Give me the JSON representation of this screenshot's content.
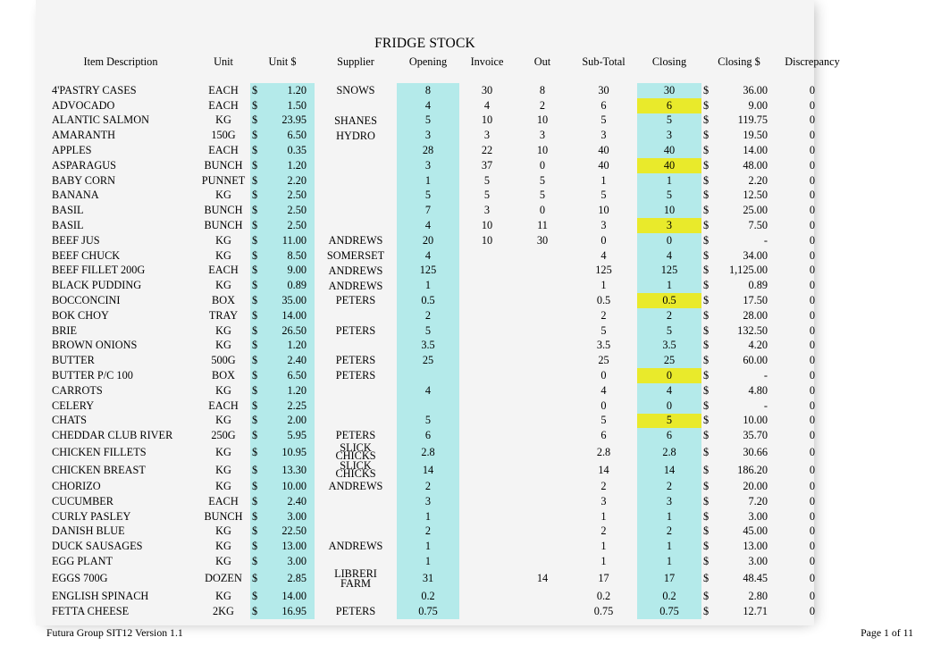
{
  "document": {
    "title": "FRIDGE STOCK",
    "footer_left": "Futura Group SIT12 Version 1.1",
    "footer_right": "Page 1 of 11"
  },
  "colors": {
    "highlight_cyan": "#b4eaea",
    "highlight_yellow": "#e9ea2b",
    "sheet_background": "#f4f4f4",
    "text": "#000000"
  },
  "table": {
    "columns": [
      "Item Description",
      "Unit",
      "Unit $",
      "Supplier",
      "Opening",
      "Invoice",
      "Out",
      "Sub-Total",
      "Closing",
      "Closing $",
      "Discrepancy"
    ],
    "currency_symbol": "$",
    "rows": [
      {
        "desc": "4'PASTRY CASES",
        "unit": "EACH",
        "price": "1.20",
        "supplier": "SNOWS",
        "opening": "8",
        "invoice": "30",
        "out": "8",
        "subtotal": "30",
        "closing": "30",
        "closing_hl": "cyan",
        "closing_dollar": "36.00",
        "discrepancy": "0"
      },
      {
        "desc": "ADVOCADO",
        "unit": "EACH",
        "price": "1.50",
        "supplier": "",
        "opening": "4",
        "invoice": "4",
        "out": "2",
        "subtotal": "6",
        "closing": "6",
        "closing_hl": "yellow",
        "closing_dollar": "9.00",
        "discrepancy": "0"
      },
      {
        "desc": "ALANTIC SALMON",
        "unit": "KG",
        "price": "23.95",
        "supplier": "SHANES",
        "opening": "5",
        "invoice": "10",
        "out": "10",
        "subtotal": "5",
        "closing": "5",
        "closing_hl": "cyan",
        "closing_dollar": "119.75",
        "discrepancy": "0"
      },
      {
        "desc": "AMARANTH",
        "unit": "150G",
        "price": "6.50",
        "supplier": "HYDRO",
        "opening": "3",
        "invoice": "3",
        "out": "3",
        "subtotal": "3",
        "closing": "3",
        "closing_hl": "cyan",
        "closing_dollar": "19.50",
        "discrepancy": "0"
      },
      {
        "desc": "APPLES",
        "unit": "EACH",
        "price": "0.35",
        "supplier": "",
        "opening": "28",
        "invoice": "22",
        "out": "10",
        "subtotal": "40",
        "closing": "40",
        "closing_hl": "cyan",
        "closing_dollar": "14.00",
        "discrepancy": "0"
      },
      {
        "desc": "ASPARAGUS",
        "unit": "BUNCH",
        "price": "1.20",
        "supplier": "",
        "opening": "3",
        "invoice": "37",
        "out": "0",
        "subtotal": "40",
        "closing": "40",
        "closing_hl": "yellow",
        "closing_dollar": "48.00",
        "discrepancy": "0"
      },
      {
        "desc": "BABY CORN",
        "unit": "PUNNET",
        "price": "2.20",
        "supplier": "",
        "opening": "1",
        "invoice": "5",
        "out": "5",
        "subtotal": "1",
        "closing": "1",
        "closing_hl": "cyan",
        "closing_dollar": "2.20",
        "discrepancy": "0"
      },
      {
        "desc": "BANANA",
        "unit": "KG",
        "price": "2.50",
        "supplier": "",
        "opening": "5",
        "invoice": "5",
        "out": "5",
        "subtotal": "5",
        "closing": "5",
        "closing_hl": "cyan",
        "closing_dollar": "12.50",
        "discrepancy": "0"
      },
      {
        "desc": "BASIL",
        "unit": "BUNCH",
        "price": "2.50",
        "supplier": "",
        "opening": "7",
        "invoice": "3",
        "out": "0",
        "subtotal": "10",
        "closing": "10",
        "closing_hl": "cyan",
        "closing_dollar": "25.00",
        "discrepancy": "0"
      },
      {
        "desc": "BASIL",
        "unit": "BUNCH",
        "price": "2.50",
        "supplier": "",
        "opening": "4",
        "invoice": "10",
        "out": "11",
        "subtotal": "3",
        "closing": "3",
        "closing_hl": "yellow",
        "closing_dollar": "7.50",
        "discrepancy": "0"
      },
      {
        "desc": "BEEF   JUS",
        "unit": "KG",
        "price": "11.00",
        "supplier": "ANDREWS",
        "opening": "20",
        "invoice": "10",
        "out": "30",
        "subtotal": "0",
        "closing": "0",
        "closing_hl": "cyan",
        "closing_dollar": "-",
        "discrepancy": "0"
      },
      {
        "desc": "BEEF CHUCK",
        "unit": "KG",
        "price": "8.50",
        "supplier": "SOMERSET",
        "opening": "4",
        "invoice": "",
        "out": "",
        "subtotal": "4",
        "closing": "4",
        "closing_hl": "cyan",
        "closing_dollar": "34.00",
        "discrepancy": "0"
      },
      {
        "desc": "BEEF FILLET 200G",
        "unit": "EACH",
        "price": "9.00",
        "supplier": "ANDREWS",
        "opening": "125",
        "invoice": "",
        "out": "",
        "subtotal": "125",
        "closing": "125",
        "closing_hl": "cyan",
        "closing_dollar": "1,125.00",
        "discrepancy": "0"
      },
      {
        "desc": "BLACK PUDDING",
        "unit": "KG",
        "price": "0.89",
        "supplier": "ANDREWS",
        "opening": "1",
        "invoice": "",
        "out": "",
        "subtotal": "1",
        "closing": "1",
        "closing_hl": "cyan",
        "closing_dollar": "0.89",
        "discrepancy": "0"
      },
      {
        "desc": "BOCCONCINI",
        "unit": "BOX",
        "price": "35.00",
        "supplier": "PETERS",
        "opening": "0.5",
        "invoice": "",
        "out": "",
        "subtotal": "0.5",
        "closing": "0.5",
        "closing_hl": "yellow",
        "closing_dollar": "17.50",
        "discrepancy": "0"
      },
      {
        "desc": "BOK CHOY",
        "unit": "TRAY",
        "price": "14.00",
        "supplier": "",
        "opening": "2",
        "invoice": "",
        "out": "",
        "subtotal": "2",
        "closing": "2",
        "closing_hl": "cyan",
        "closing_dollar": "28.00",
        "discrepancy": "0"
      },
      {
        "desc": "BRIE",
        "unit": "KG",
        "price": "26.50",
        "supplier": "PETERS",
        "opening": "5",
        "invoice": "",
        "out": "",
        "subtotal": "5",
        "closing": "5",
        "closing_hl": "cyan",
        "closing_dollar": "132.50",
        "discrepancy": "0"
      },
      {
        "desc": "BROWN ONIONS",
        "unit": "KG",
        "price": "1.20",
        "supplier": "",
        "opening": "3.5",
        "invoice": "",
        "out": "",
        "subtotal": "3.5",
        "closing": "3.5",
        "closing_hl": "cyan",
        "closing_dollar": "4.20",
        "discrepancy": "0"
      },
      {
        "desc": "BUTTER",
        "unit": "500G",
        "price": "2.40",
        "supplier": "PETERS",
        "opening": "25",
        "invoice": "",
        "out": "",
        "subtotal": "25",
        "closing": "25",
        "closing_hl": "cyan",
        "closing_dollar": "60.00",
        "discrepancy": "0"
      },
      {
        "desc": "BUTTER P/C 100",
        "unit": "BOX",
        "price": "6.50",
        "supplier": "PETERS",
        "opening": "",
        "invoice": "",
        "out": "",
        "subtotal": "0",
        "closing": "0",
        "closing_hl": "yellow",
        "closing_dollar": "-",
        "discrepancy": "0"
      },
      {
        "desc": "CARROTS",
        "unit": "KG",
        "price": "1.20",
        "supplier": "",
        "opening": "4",
        "invoice": "",
        "out": "",
        "subtotal": "4",
        "closing": "4",
        "closing_hl": "cyan",
        "closing_dollar": "4.80",
        "discrepancy": "0"
      },
      {
        "desc": "CELERY",
        "unit": "EACH",
        "price": "2.25",
        "supplier": "",
        "opening": "",
        "invoice": "",
        "out": "",
        "subtotal": "0",
        "closing": "0",
        "closing_hl": "cyan",
        "closing_dollar": "-",
        "discrepancy": "0"
      },
      {
        "desc": "CHATS",
        "unit": "KG",
        "price": "2.00",
        "supplier": "",
        "opening": "5",
        "invoice": "",
        "out": "",
        "subtotal": "5",
        "closing": "5",
        "closing_hl": "yellow",
        "closing_dollar": "10.00",
        "discrepancy": "0"
      },
      {
        "desc": "CHEDDAR CLUB RIVER",
        "unit": "250G",
        "price": "5.95",
        "supplier": "PETERS",
        "opening": "6",
        "invoice": "",
        "out": "",
        "subtotal": "6",
        "closing": "6",
        "closing_hl": "cyan",
        "closing_dollar": "35.70",
        "discrepancy": "0"
      },
      {
        "desc": "CHICKEN   FILLETS",
        "unit": "KG",
        "price": "10.95",
        "supplier": "SLICK CHICKS",
        "supplier_overlap": true,
        "opening": "2.8",
        "invoice": "",
        "out": "",
        "subtotal": "2.8",
        "closing": "2.8",
        "closing_hl": "cyan",
        "closing_dollar": "30.66",
        "discrepancy": "0"
      },
      {
        "desc": "CHICKEN BREAST",
        "unit": "KG",
        "price": "13.30",
        "supplier": "SLICK CHICKS",
        "supplier_overlap": true,
        "opening": "14",
        "invoice": "",
        "out": "",
        "subtotal": "14",
        "closing": "14",
        "closing_hl": "cyan",
        "closing_dollar": "186.20",
        "discrepancy": "0"
      },
      {
        "desc": "CHORIZO",
        "unit": "KG",
        "price": "10.00",
        "supplier": "ANDREWS",
        "opening": "2",
        "invoice": "",
        "out": "",
        "subtotal": "2",
        "closing": "2",
        "closing_hl": "cyan",
        "closing_dollar": "20.00",
        "discrepancy": "0"
      },
      {
        "desc": "CUCUMBER",
        "unit": "EACH",
        "price": "2.40",
        "supplier": "",
        "opening": "3",
        "invoice": "",
        "out": "",
        "subtotal": "3",
        "closing": "3",
        "closing_hl": "cyan",
        "closing_dollar": "7.20",
        "discrepancy": "0"
      },
      {
        "desc": "CURLY PASLEY",
        "unit": "BUNCH",
        "price": "3.00",
        "supplier": "",
        "opening": "1",
        "invoice": "",
        "out": "",
        "subtotal": "1",
        "closing": "1",
        "closing_hl": "cyan",
        "closing_dollar": "3.00",
        "discrepancy": "0"
      },
      {
        "desc": "DANISH BLUE",
        "unit": "KG",
        "price": "22.50",
        "supplier": "",
        "opening": "2",
        "invoice": "",
        "out": "",
        "subtotal": "2",
        "closing": "2",
        "closing_hl": "cyan",
        "closing_dollar": "45.00",
        "discrepancy": "0"
      },
      {
        "desc": "DUCK SAUSAGES",
        "unit": "KG",
        "price": "13.00",
        "supplier": "ANDREWS",
        "opening": "1",
        "invoice": "",
        "out": "",
        "subtotal": "1",
        "closing": "1",
        "closing_hl": "cyan",
        "closing_dollar": "13.00",
        "discrepancy": "0"
      },
      {
        "desc": "EGG PLANT",
        "unit": "KG",
        "price": "3.00",
        "supplier": "",
        "opening": "1",
        "invoice": "",
        "out": "",
        "subtotal": "1",
        "closing": "1",
        "closing_hl": "cyan",
        "closing_dollar": "3.00",
        "discrepancy": "0"
      },
      {
        "desc": "EGGS 700G",
        "unit": "DOZEN",
        "price": "2.85",
        "supplier": "LIBRERI FARM",
        "supplier_wrap": true,
        "opening": "31",
        "invoice": "",
        "out": "14",
        "subtotal": "17",
        "closing": "17",
        "closing_hl": "cyan",
        "closing_dollar": "48.45",
        "discrepancy": "0"
      },
      {
        "desc": "ENGLISH SPINACH",
        "unit": "KG",
        "price": "14.00",
        "supplier": "",
        "opening": "0.2",
        "invoice": "",
        "out": "",
        "subtotal": "0.2",
        "closing": "0.2",
        "closing_hl": "cyan",
        "closing_dollar": "2.80",
        "discrepancy": "0"
      },
      {
        "desc": "FETTA CHEESE",
        "unit": "2KG",
        "price": "16.95",
        "supplier": "PETERS",
        "opening": "0.75",
        "invoice": "",
        "out": "",
        "subtotal": "0.75",
        "closing": "0.75",
        "closing_hl": "cyan",
        "closing_dollar": "12.71",
        "discrepancy": "0"
      }
    ]
  }
}
